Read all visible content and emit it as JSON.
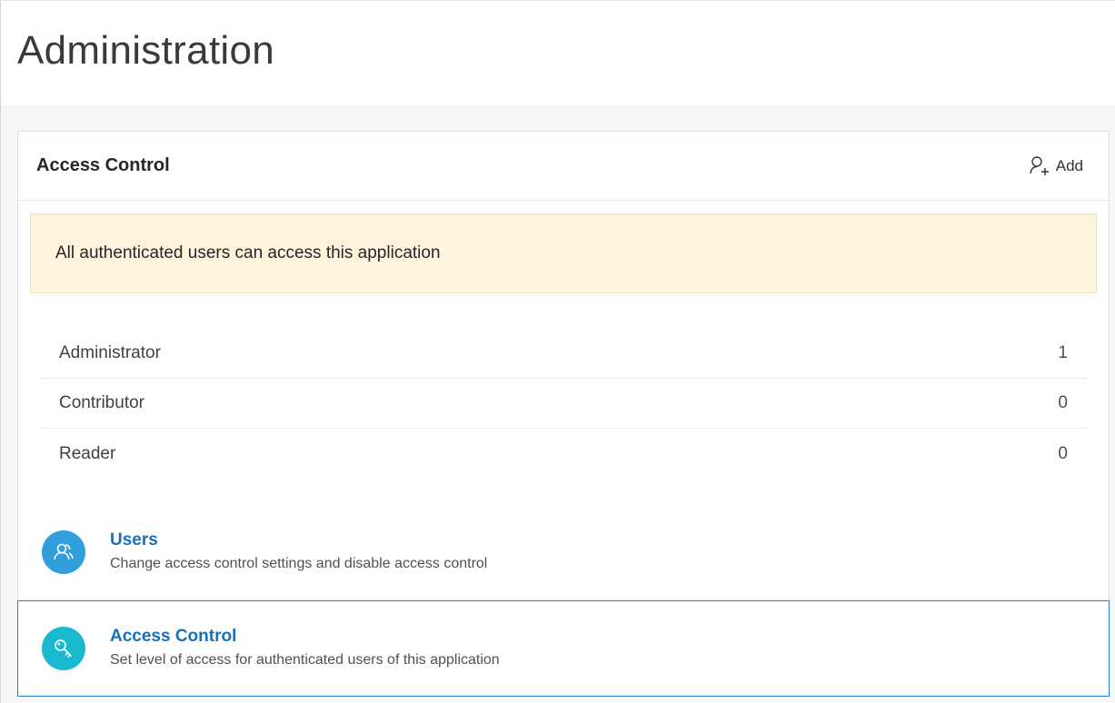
{
  "page": {
    "title": "Administration"
  },
  "access_region": {
    "title": "Access Control",
    "add_label": "Add",
    "alert_text": "All authenticated users can access this application",
    "roles": [
      {
        "name": "Administrator",
        "count": "1"
      },
      {
        "name": "Contributor",
        "count": "0"
      },
      {
        "name": "Reader",
        "count": "0"
      }
    ]
  },
  "nav_cards": {
    "users": {
      "title": "Users",
      "description": "Change access control settings and disable access control",
      "icon": "users-icon"
    },
    "access_control": {
      "title": "Access Control",
      "description": "Set level of access for authenticated users of this application",
      "icon": "key-icon"
    }
  },
  "colors": {
    "link": "#1a6fb8",
    "alert_bg": "#fcf4dd",
    "users_icon_bg": "#309fdb",
    "key_icon_bg": "#19b9cf",
    "selected_border": "#2a7fc9"
  }
}
